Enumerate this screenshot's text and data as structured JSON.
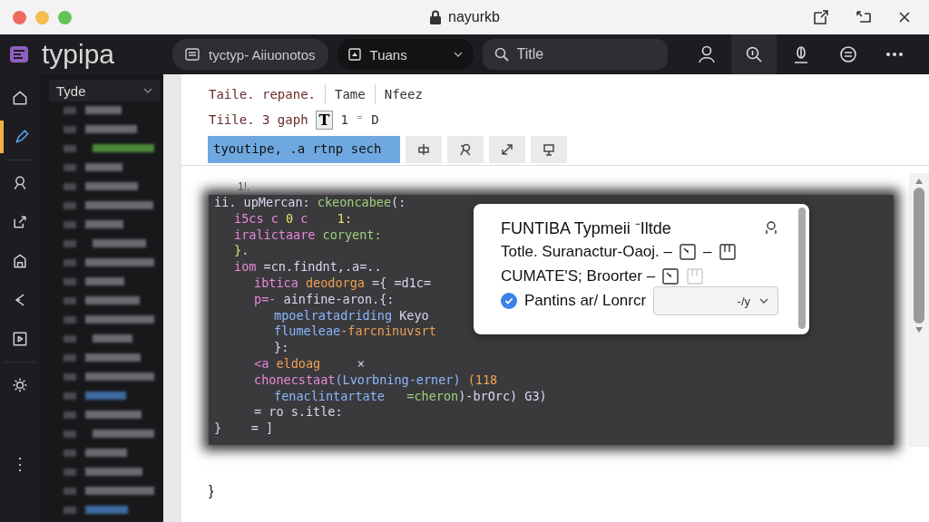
{
  "window": {
    "title": "nayurkb"
  },
  "toolbar": {
    "app_name": "typipa",
    "breadcrumb": "tyctyp- Aiiuonotos",
    "dropdown": "Tuans",
    "search": {
      "placeholder": "Title"
    }
  },
  "rail": {
    "items": [
      {
        "selected": false
      },
      {
        "selected": true
      },
      {
        "selected": false
      },
      {
        "selected": false
      },
      {
        "selected": false
      },
      {
        "selected": false
      },
      {
        "selected": false
      },
      {
        "selected": false
      }
    ],
    "more": "⋮"
  },
  "sidebar": {
    "dropdown": "Tyde"
  },
  "editor": {
    "line1": [
      "Taile. repane.",
      "Tame",
      "Nfeez"
    ],
    "line2": {
      "text": "Tiile.  3 gaph",
      "cursor": "T",
      "after": "1  ⁼  D"
    },
    "highlight": "tyoutipe, .a rtnp sech",
    "code_label": "1!.",
    "code": [
      {
        "parts": [
          {
            "t": "ii. upMercan: ",
            "kind": "plain"
          },
          {
            "t": "ckeoncabee",
            "kind": "string"
          },
          {
            "t": "(:",
            "kind": "plain"
          }
        ],
        "children": [
          {
            "parts": [
              {
                "t": "i5cs c ",
                "kind": "keyword"
              },
              {
                "t": "0",
                "kind": "number"
              },
              {
                "t": " c    ",
                "kind": "keyword"
              },
              {
                "t": "1:",
                "kind": "number"
              }
            ]
          },
          {
            "parts": [
              {
                "t": "iralictaare ",
                "kind": "keyword"
              },
              {
                "t": "coryent:",
                "kind": "string"
              }
            ]
          },
          {
            "parts": [
              {
                "t": "}.",
                "kind": "number"
              }
            ]
          },
          {
            "parts": [
              {
                "t": "iom ",
                "kind": "keyword"
              },
              {
                "t": "=cn.findnt,.a=..",
                "kind": "plain"
              }
            ],
            "children": [
              {
                "parts": [
                  {
                    "t": "ibtica ",
                    "kind": "keyword"
                  },
                  {
                    "t": "deodorga ",
                    "kind": "name"
                  },
                  {
                    "t": "={ =d1c=",
                    "kind": "plain"
                  }
                ]
              },
              {
                "parts": [
                  {
                    "t": "p=- ",
                    "kind": "keyword"
                  },
                  {
                    "t": "ainfine-aron.{:",
                    "kind": "plain"
                  }
                ],
                "children": [
                  {
                    "parts": [
                      {
                        "t": "mpoelratadriding ",
                        "kind": "func"
                      },
                      {
                        "t": "Keyo",
                        "kind": "plain"
                      }
                    ]
                  },
                  {
                    "parts": [
                      {
                        "t": "flumeleae",
                        "kind": "func"
                      },
                      {
                        "t": "-farcninuvsrt",
                        "kind": "name"
                      }
                    ]
                  },
                  {
                    "parts": [
                      {
                        "t": "}:",
                        "kind": "plain"
                      }
                    ]
                  }
                ]
              },
              {
                "parts": [
                  {
                    "t": "<a ",
                    "kind": "keyword"
                  },
                  {
                    "t": "eldoag     ",
                    "kind": "name"
                  },
                  {
                    "t": "×",
                    "kind": "plain"
                  }
                ]
              },
              {
                "parts": [
                  {
                    "t": "chonecstaat",
                    "kind": "keyword"
                  },
                  {
                    "t": "(Lvorbning-erner)",
                    "kind": "func"
                  },
                  {
                    "t": " (118",
                    "kind": "name"
                  }
                ],
                "children": [
                  {
                    "parts": [
                      {
                        "t": "fenaclintartate   ",
                        "kind": "func"
                      },
                      {
                        "t": "=cheron",
                        "kind": "string"
                      },
                      {
                        "t": ")-brOrc) G3)",
                        "kind": "plain"
                      }
                    ]
                  }
                ]
              },
              {
                "parts": [
                  {
                    "t": "= ro s.itle:",
                    "kind": "plain"
                  }
                ]
              }
            ]
          }
        ]
      },
      {
        "parts": [
          {
            "t": "}    = ]",
            "kind": "plain"
          }
        ]
      }
    ],
    "closing": "}"
  },
  "popup": {
    "title": "FUNTIBA Typmeii ⁻Iltde",
    "rows": [
      {
        "text": "Totle. Suranactur-Oaoj.  –",
        "extra": "–"
      },
      {
        "text": "CUMATE'S; Broorter  –"
      }
    ],
    "checkbox": {
      "label": "Pantins ar/ Lonrcr",
      "checked": true
    },
    "select": {
      "value": "-/y"
    }
  }
}
